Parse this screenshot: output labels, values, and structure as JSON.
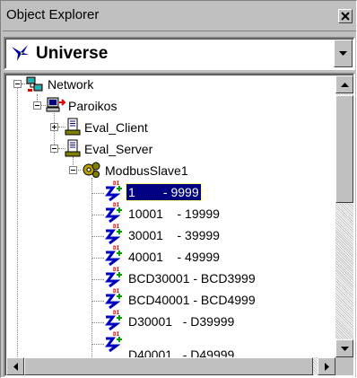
{
  "window": {
    "title": "Object Explorer",
    "close_icon": "close-icon"
  },
  "universe": {
    "label": "Universe",
    "icon": "universe-icon"
  },
  "tree": {
    "network": {
      "label": "Network",
      "icon": "network-icon",
      "expanded": true
    },
    "computer": {
      "label": "Paroikos",
      "icon": "computer-icon",
      "expanded": true
    },
    "eval_client": {
      "label": "Eval_Client",
      "icon": "process-icon",
      "expanded": false
    },
    "eval_server": {
      "label": "Eval_Server",
      "icon": "process-icon",
      "expanded": true
    },
    "modbus": {
      "label": "ModbusSlave1",
      "icon": "device-icon",
      "expanded": true
    },
    "items": [
      {
        "label": "1        - 9999",
        "icon": "digital-io-icon",
        "selected": true
      },
      {
        "label": "10001    - 19999",
        "icon": "digital-io-icon",
        "selected": false
      },
      {
        "label": "30001    - 39999",
        "icon": "digital-io-icon",
        "selected": false
      },
      {
        "label": "40001    - 49999",
        "icon": "digital-io-icon",
        "selected": false
      },
      {
        "label": "BCD30001 - BCD3999",
        "icon": "digital-io-icon",
        "selected": false
      },
      {
        "label": "BCD40001 - BCD4999",
        "icon": "digital-io-icon",
        "selected": false
      },
      {
        "label": "D30001   - D39999",
        "icon": "digital-io-icon",
        "selected": false
      },
      {
        "label": "D40001   - D49999",
        "icon": "digital-io-icon",
        "selected": false
      }
    ]
  },
  "colors": {
    "selection": "#000080",
    "face": "#c0c0c0"
  }
}
